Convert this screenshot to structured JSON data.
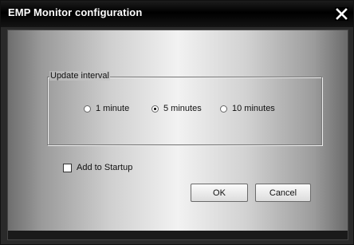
{
  "window": {
    "title": "EMP Monitor configuration"
  },
  "update_interval": {
    "label": "Update interval",
    "options": [
      {
        "label": "1 minute",
        "selected": false
      },
      {
        "label": "5 minutes",
        "selected": true
      },
      {
        "label": "10 minutes",
        "selected": false
      }
    ]
  },
  "startup": {
    "label": "Add to Startup",
    "checked": false
  },
  "buttons": {
    "ok": "OK",
    "cancel": "Cancel"
  },
  "colors": {
    "titlebar": "#000000",
    "title_text": "#ffffff",
    "body_highlight": "#f2f2f2"
  },
  "icons": {
    "close": "close-icon"
  }
}
